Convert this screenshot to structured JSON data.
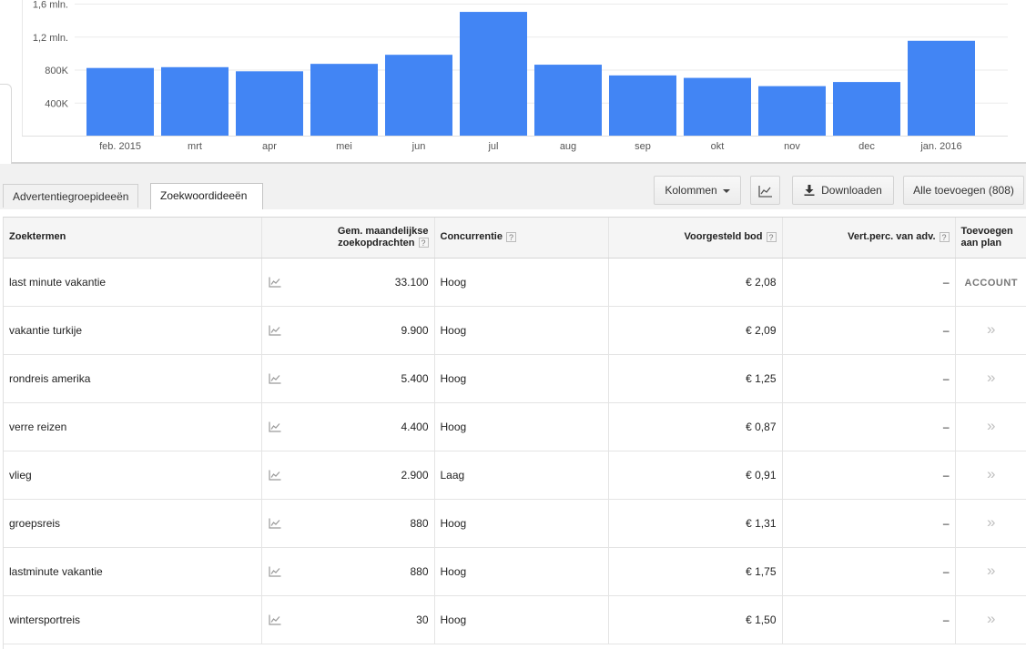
{
  "colors": {
    "bar": "#4285f4",
    "gridline": "#ebebeb",
    "header_bg": "#f5f5f5",
    "toolbar_bg": "#f1f1f1"
  },
  "chart_data": {
    "type": "bar",
    "categories": [
      "feb. 2015",
      "mrt",
      "apr",
      "mei",
      "jun",
      "jul",
      "aug",
      "sep",
      "okt",
      "nov",
      "dec",
      "jan. 2016"
    ],
    "values": [
      820000,
      830000,
      780000,
      870000,
      980000,
      1500000,
      860000,
      730000,
      700000,
      600000,
      650000,
      1150000
    ],
    "yticks": [
      {
        "value": 400000,
        "label": "400K"
      },
      {
        "value": 800000,
        "label": "800K"
      },
      {
        "value": 1200000,
        "label": "1,2 mln."
      },
      {
        "value": 1600000,
        "label": "1,6 mln."
      }
    ],
    "ylim": [
      0,
      1600000
    ],
    "grid": true,
    "legend": "none"
  },
  "tabs": [
    {
      "label": "Advertentiegroepideeën",
      "active": false
    },
    {
      "label": "Zoekwoordideeën",
      "active": true
    }
  ],
  "toolbar": {
    "columns_label": "Kolommen",
    "download_label": "Downloaden",
    "add_all_label": "Alle toevoegen (808)"
  },
  "icons": {
    "chart": "line-chart-icon",
    "download": "download-icon",
    "help": "help-icon",
    "add": "double-chevron-right-icon"
  },
  "table": {
    "headers": {
      "term": "Zoektermen",
      "avg_line1": "Gem. maandelijkse",
      "avg_line2": "zoekopdrachten",
      "competition": "Concurrentie",
      "bid": "Voorgesteld bod",
      "share": "Vert.perc. van adv.",
      "add_line1": "Toevoegen",
      "add_line2": "aan plan",
      "help_mark": "?"
    },
    "rows": [
      {
        "term": "last minute vakantie",
        "avg": "33.100",
        "competition": "Hoog",
        "bid": "€ 2,08",
        "share": "–",
        "add": "ACCOUNT"
      },
      {
        "term": "vakantie turkije",
        "avg": "9.900",
        "competition": "Hoog",
        "bid": "€ 2,09",
        "share": "–",
        "add": "»"
      },
      {
        "term": "rondreis amerika",
        "avg": "5.400",
        "competition": "Hoog",
        "bid": "€ 1,25",
        "share": "–",
        "add": "»"
      },
      {
        "term": "verre reizen",
        "avg": "4.400",
        "competition": "Hoog",
        "bid": "€ 0,87",
        "share": "–",
        "add": "»"
      },
      {
        "term": "vlieg",
        "avg": "2.900",
        "competition": "Laag",
        "bid": "€ 0,91",
        "share": "–",
        "add": "»"
      },
      {
        "term": "groepsreis",
        "avg": "880",
        "competition": "Hoog",
        "bid": "€ 1,31",
        "share": "–",
        "add": "»"
      },
      {
        "term": "lastminute vakantie",
        "avg": "880",
        "competition": "Hoog",
        "bid": "€ 1,75",
        "share": "–",
        "add": "»"
      },
      {
        "term": "wintersportreis",
        "avg": "30",
        "competition": "Hoog",
        "bid": "€ 1,50",
        "share": "–",
        "add": "»"
      }
    ]
  }
}
